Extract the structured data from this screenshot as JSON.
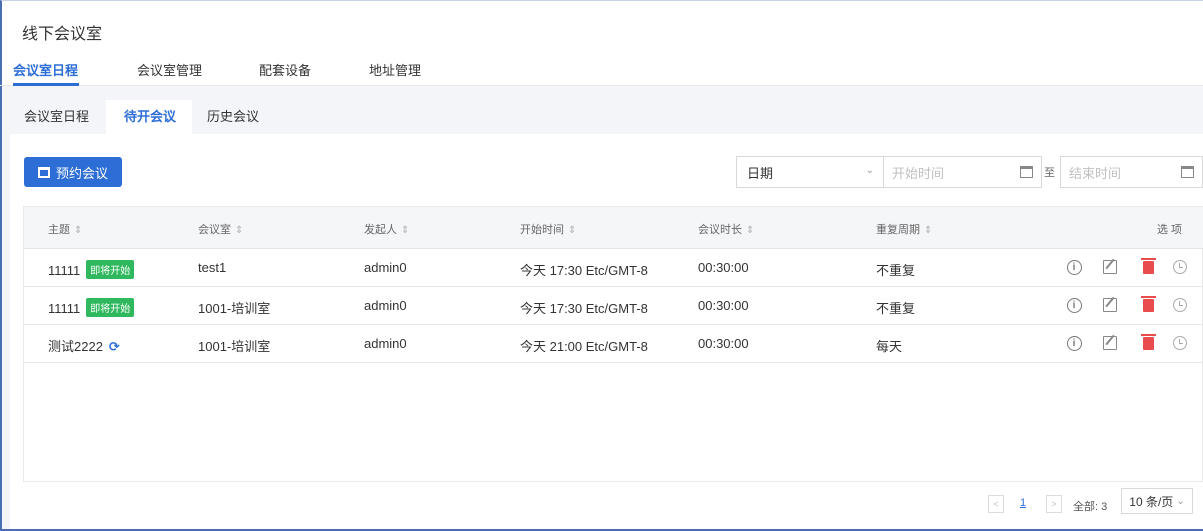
{
  "page_title": "线下会议室",
  "top_tabs": [
    "会议室日程",
    "会议室管理",
    "配套设备",
    "地址管理"
  ],
  "sub_tabs": [
    "会议室日程",
    "待开会议",
    "历史会议"
  ],
  "toolbar": {
    "book_label": "预约会议",
    "date_select": "日期",
    "start_placeholder": "开始时间",
    "to_label": "至",
    "end_placeholder": "结束时间"
  },
  "table": {
    "headers": [
      "主题",
      "会议室",
      "发起人",
      "开始时间",
      "会议时长",
      "重复周期",
      "选 项"
    ],
    "rows": [
      {
        "subject": "11111",
        "badge": "即将开始",
        "room": "test1",
        "host": "admin0",
        "start": "今天 17:30 Etc/GMT-8",
        "duration": "00:30:00",
        "repeat": "不重复"
      },
      {
        "subject": "11111",
        "badge": "即将开始",
        "room": "1001-培训室",
        "host": "admin0",
        "start": "今天 17:30 Etc/GMT-8",
        "duration": "00:30:00",
        "repeat": "不重复"
      },
      {
        "subject": "测试2222",
        "badge": "",
        "room": "1001-培训室",
        "host": "admin0",
        "start": "今天 21:00 Etc/GMT-8",
        "duration": "00:30:00",
        "repeat": "每天"
      }
    ]
  },
  "pagination": {
    "current_page": "1",
    "total": "全部: 3",
    "page_size": "10 条/页"
  },
  "colors": {
    "accent": "#2c6ed5",
    "badge": "#2fb85d",
    "danger": "#e84c4c"
  }
}
